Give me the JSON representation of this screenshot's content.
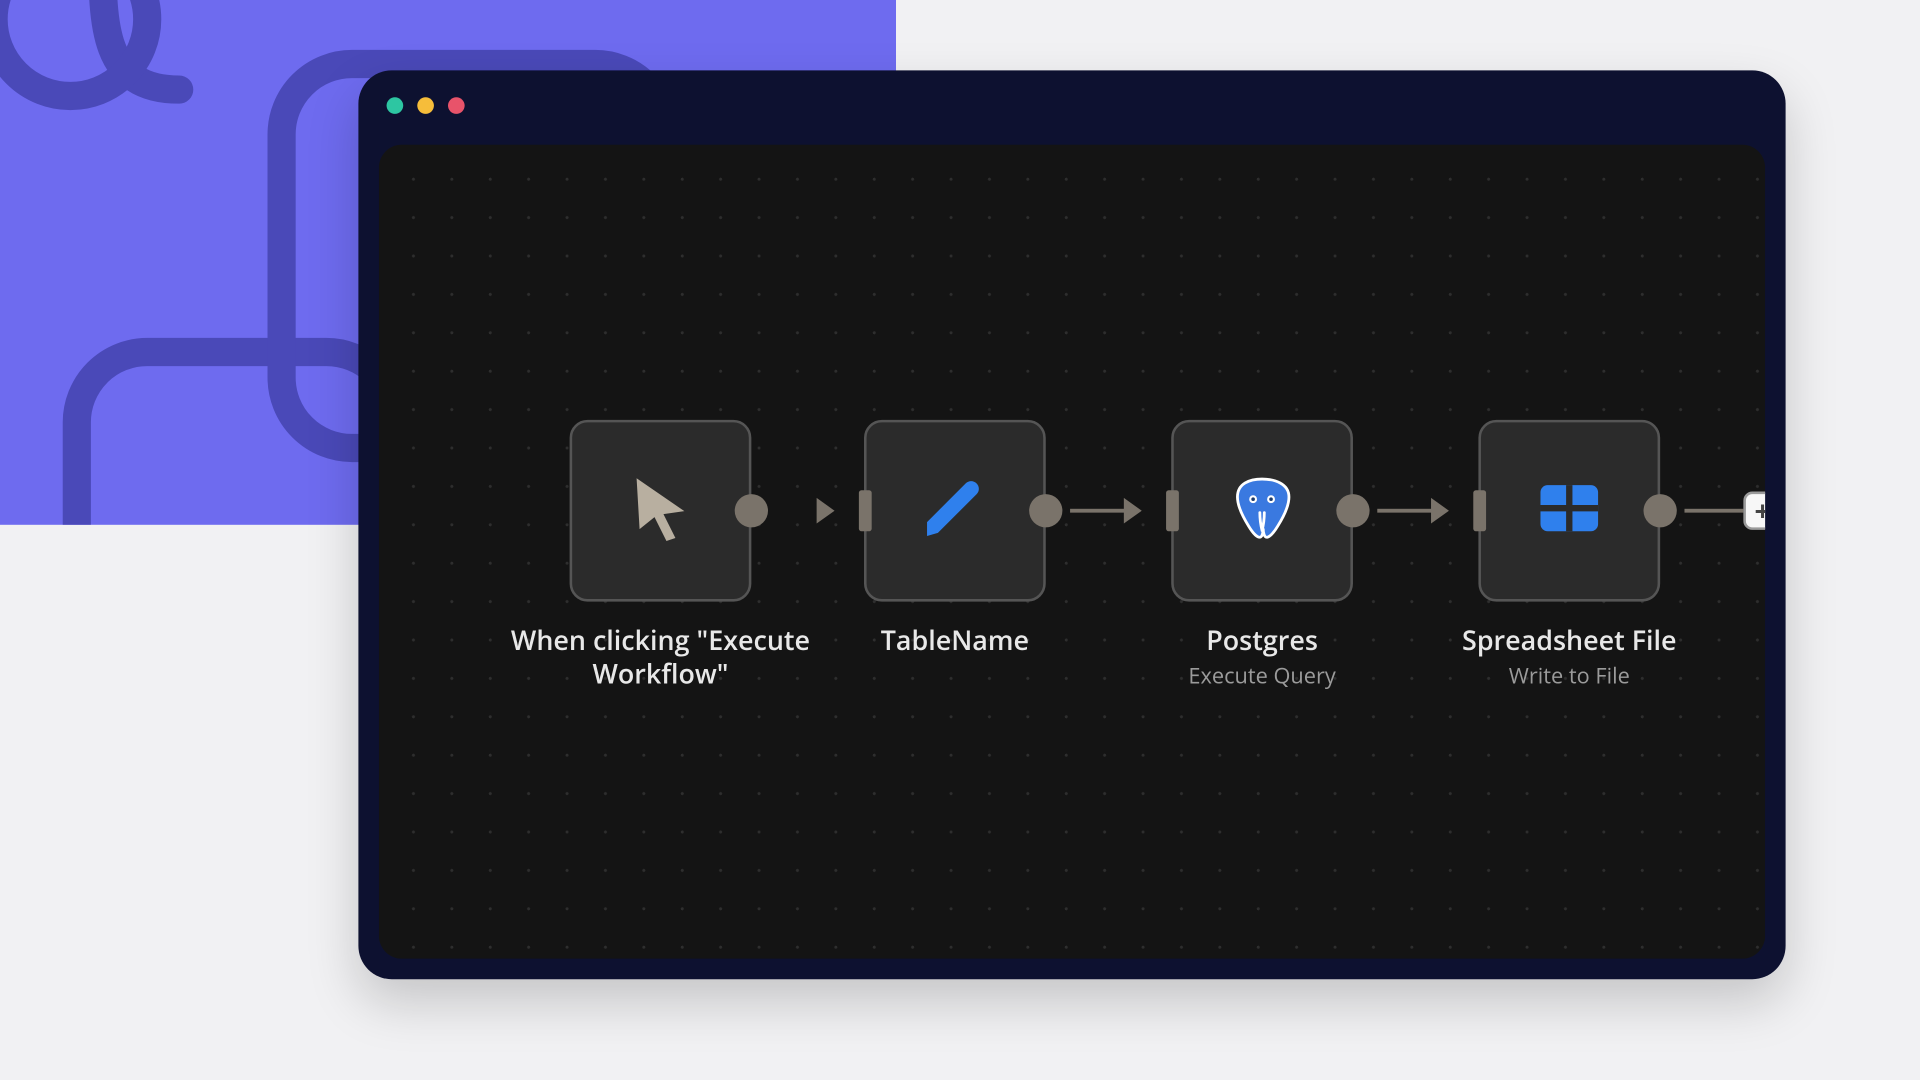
{
  "window": {
    "traffic_lights": {
      "close": "close",
      "minimize": "minimize",
      "maximize": "maximize"
    }
  },
  "workflow": {
    "nodes": [
      {
        "title": "When clicking \"Execute Workflow\"",
        "subtitle": "",
        "icon": "cursor-icon"
      },
      {
        "title": "TableName",
        "subtitle": "",
        "icon": "pencil-icon"
      },
      {
        "title": "Postgres",
        "subtitle": "Execute Query",
        "icon": "postgres-icon"
      },
      {
        "title": "Spreadsheet File",
        "subtitle": "Write to File",
        "icon": "spreadsheet-icon"
      }
    ],
    "add_label": "+"
  },
  "colors": {
    "accent_purple": "#6E6BEF",
    "accent_blue": "#2F80ED",
    "window_bg": "#0D1130",
    "canvas_bg": "#141414"
  }
}
